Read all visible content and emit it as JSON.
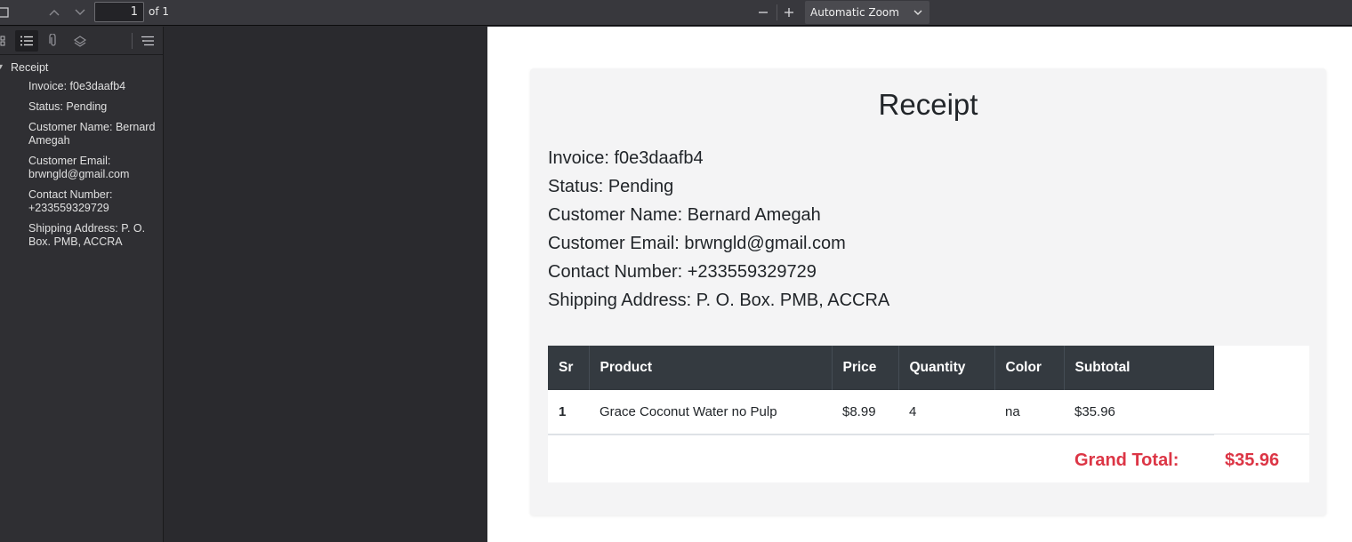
{
  "toolbar": {
    "page_number": "1",
    "page_count": "of 1",
    "zoom": "Automatic Zoom"
  },
  "outline": {
    "root": "Receipt",
    "items": [
      "Invoice: f0e3daafb4",
      "Status: Pending",
      "Customer Name: Bernard Amegah",
      "Customer Email: brwngld@gmail.com",
      "Contact Number: +233559329729",
      "Shipping Address: P. O. Box. PMB, ACCRA"
    ]
  },
  "receipt": {
    "title": "Receipt",
    "invoice": "Invoice: f0e3daafb4",
    "status": "Status: Pending",
    "customer_name": "Customer Name: Bernard Amegah",
    "customer_email": "Customer Email: brwngld@gmail.com",
    "contact_number": "Contact Number: +233559329729",
    "shipping_address": "Shipping Address: P. O. Box. PMB, ACCRA",
    "table": {
      "headers": [
        "Sr",
        "Product",
        "Price",
        "Quantity",
        "Color",
        "Subtotal"
      ],
      "rows": [
        [
          "1",
          "Grace Coconut Water no Pulp",
          "$8.99",
          "4",
          "na",
          "$35.96"
        ]
      ]
    },
    "grand_total_label": "Grand Total:",
    "grand_total_value": "$35.96",
    "accent_color": "#dc3545",
    "header_color": "#343a40"
  }
}
